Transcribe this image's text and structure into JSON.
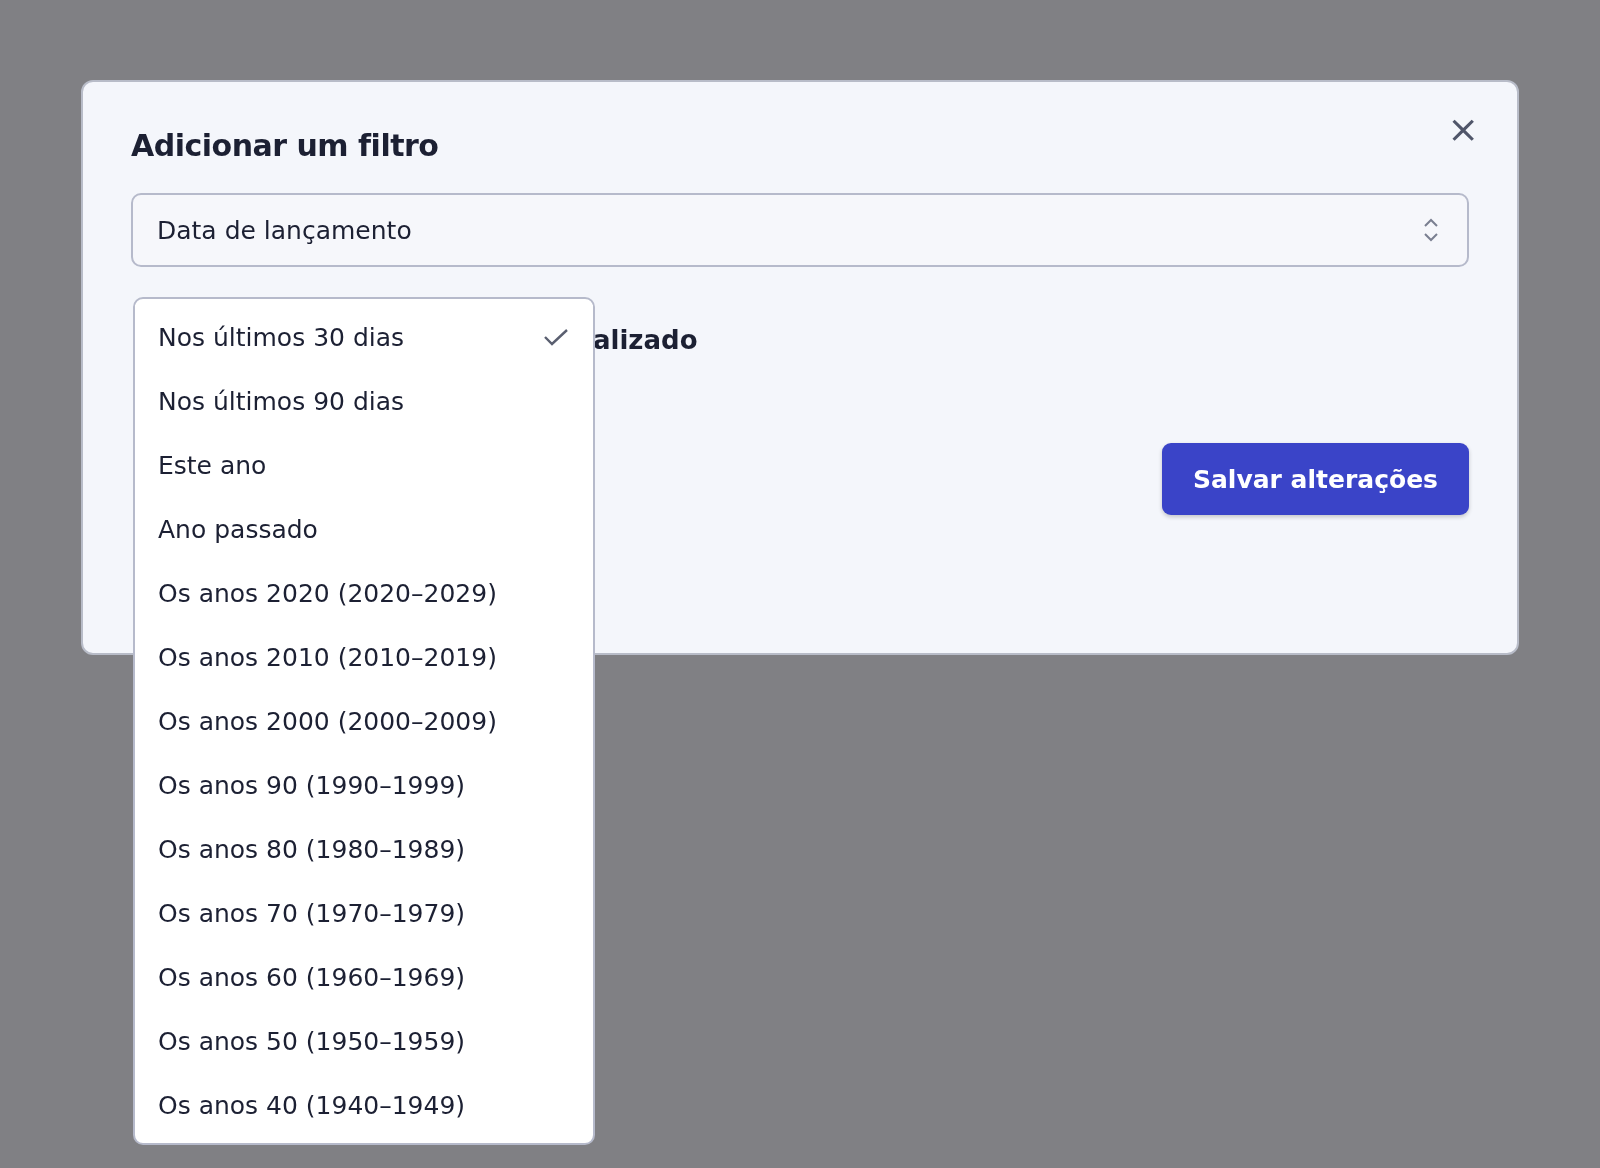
{
  "dialog": {
    "title": "Adicionar um filtro",
    "close_icon": "×"
  },
  "field_select": {
    "value": "Data de lançamento"
  },
  "partial_label": "alizado",
  "save_button": "Salvar alterações",
  "dropdown": [
    {
      "label": "Nos últimos 30 dias",
      "selected": true
    },
    {
      "label": "Nos últimos 90 dias",
      "selected": false
    },
    {
      "label": "Este ano",
      "selected": false
    },
    {
      "label": "Ano passado",
      "selected": false
    },
    {
      "label": "Os anos 2020 (2020–2029)",
      "selected": false
    },
    {
      "label": "Os anos 2010 (2010–2019)",
      "selected": false
    },
    {
      "label": "Os anos 2000 (2000–2009)",
      "selected": false
    },
    {
      "label": "Os anos 90 (1990–1999)",
      "selected": false
    },
    {
      "label": "Os anos 80 (1980–1989)",
      "selected": false
    },
    {
      "label": "Os anos 70 (1970–1979)",
      "selected": false
    },
    {
      "label": "Os anos 60 (1960–1969)",
      "selected": false
    },
    {
      "label": "Os anos 50 (1950–1959)",
      "selected": false
    },
    {
      "label": "Os anos 40 (1940–1949)",
      "selected": false
    }
  ]
}
